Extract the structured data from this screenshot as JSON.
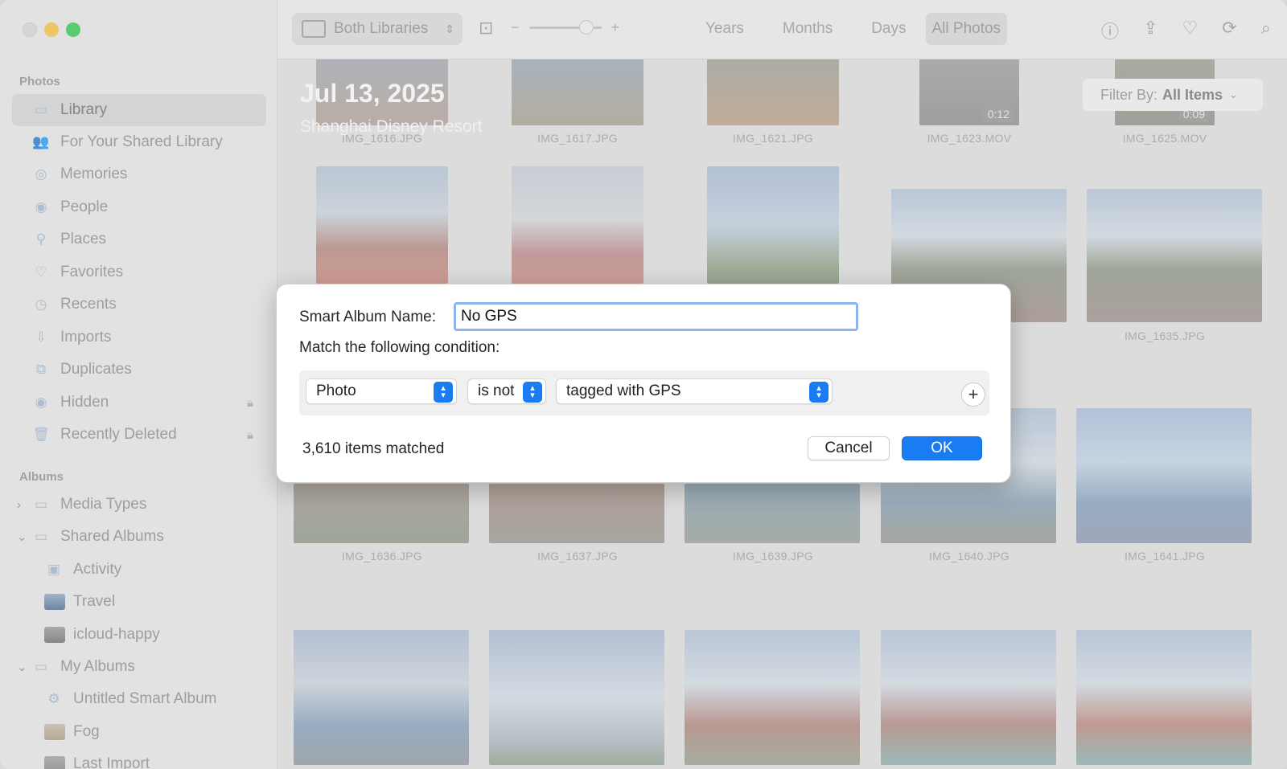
{
  "sidebar": {
    "sections": {
      "photos": "Photos",
      "albums": "Albums"
    },
    "photo_items": [
      {
        "label": "Library",
        "icon": "library-icon"
      },
      {
        "label": "For Your Shared Library",
        "icon": "shared-people-icon"
      },
      {
        "label": "Memories",
        "icon": "memories-icon"
      },
      {
        "label": "People",
        "icon": "person-icon"
      },
      {
        "label": "Places",
        "icon": "pin-icon"
      },
      {
        "label": "Favorites",
        "icon": "heart-icon"
      },
      {
        "label": "Recents",
        "icon": "clock-icon"
      },
      {
        "label": "Imports",
        "icon": "import-icon"
      },
      {
        "label": "Duplicates",
        "icon": "duplicates-icon"
      },
      {
        "label": "Hidden",
        "icon": "eye-icon",
        "locked": true
      },
      {
        "label": "Recently Deleted",
        "icon": "trash-icon",
        "locked": true
      }
    ],
    "album_items": [
      {
        "label": "Media Types"
      },
      {
        "label": "Shared Albums"
      },
      {
        "label": "Activity"
      },
      {
        "label": "Travel"
      },
      {
        "label": "icloud-happy"
      },
      {
        "label": "My Albums"
      },
      {
        "label": "Untitled Smart Album"
      },
      {
        "label": "Fog"
      },
      {
        "label": "Last Import"
      }
    ]
  },
  "toolbar": {
    "library_picker": "Both Libraries",
    "zoom_minus": "−",
    "zoom_plus": "+",
    "tabs": [
      "Years",
      "Months",
      "Days",
      "All Photos"
    ],
    "active_tab": "All Photos"
  },
  "main": {
    "date_title": "Jul 13, 2025",
    "location": "Shanghai Disney Resort",
    "filter_label": "Filter By:",
    "filter_value": "All Items",
    "row1": [
      {
        "name": "IMG_1616.JPG"
      },
      {
        "name": "IMG_1617.JPG"
      },
      {
        "name": "IMG_1621.JPG"
      },
      {
        "name": "IMG_1623.MOV",
        "duration": "0:12"
      },
      {
        "name": "IMG_1625.MOV",
        "duration": "0:09"
      }
    ],
    "row2": [
      {
        "name": ""
      },
      {
        "name": ""
      },
      {
        "name": ""
      },
      {
        "name": "PG"
      },
      {
        "name": "IMG_1635.JPG"
      }
    ],
    "row3": [
      {
        "name": "IMG_1636.JPG"
      },
      {
        "name": "IMG_1637.JPG"
      },
      {
        "name": "IMG_1639.JPG"
      },
      {
        "name": "IMG_1640.JPG"
      },
      {
        "name": "IMG_1641.JPG"
      }
    ]
  },
  "dialog": {
    "name_label": "Smart Album Name:",
    "name_value": "No GPS",
    "condition_label": "Match the following condition:",
    "field": "Photo",
    "operator": "is not",
    "value": "tagged with GPS",
    "add_symbol": "+",
    "matched_text": "3,610 items matched",
    "cancel_label": "Cancel",
    "ok_label": "OK"
  },
  "colors": {
    "accent": "#1a7cf2",
    "focus_ring": "#8fb3ef"
  }
}
